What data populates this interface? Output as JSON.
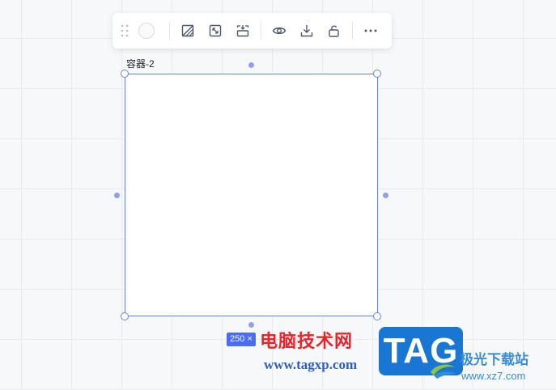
{
  "toolbar": {
    "items": [
      {
        "name": "drag-handle-icon"
      },
      {
        "name": "fill-color-swatch",
        "color": "#fafafa"
      },
      {
        "name": "shape-style-icon"
      },
      {
        "name": "fit-size-icon"
      },
      {
        "name": "align-icon"
      },
      {
        "name": "visibility-eye-icon"
      },
      {
        "name": "download-icon"
      },
      {
        "name": "unlock-icon"
      },
      {
        "name": "more-icon"
      }
    ]
  },
  "container": {
    "label": "容器-2",
    "size_badge": "250 ×",
    "border_color": "#6b83e6"
  },
  "watermark": {
    "cn_text": "电脑技术网",
    "url": "www.tagxp.com",
    "tag": "TAG",
    "site_name": "极光下载站",
    "site_url": "www.xz7.com"
  }
}
